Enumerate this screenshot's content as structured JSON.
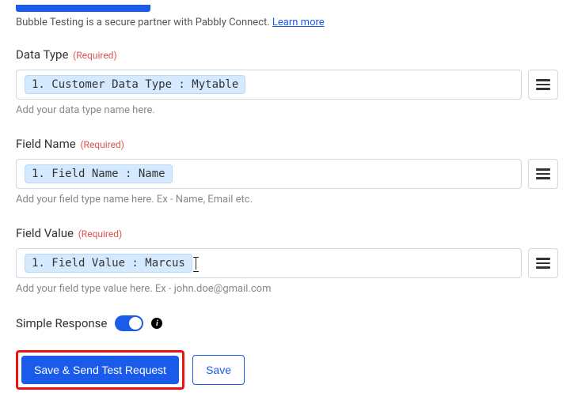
{
  "note": {
    "text_prefix": "Bubble Testing is a secure partner with Pabbly Connect. ",
    "link_text": "Learn more"
  },
  "fields": {
    "dataType": {
      "label": "Data Type",
      "required": "(Required)",
      "chip": "1. Customer Data Type : Mytable",
      "helper": "Add your data type name here."
    },
    "fieldName": {
      "label": "Field Name",
      "required": "(Required)",
      "chip": "1. Field Name : Name",
      "helper": "Add your field type name here. Ex - Name, Email etc."
    },
    "fieldValue": {
      "label": "Field Value",
      "required": "(Required)",
      "chip": "1. Field Value : Marcus",
      "helper": "Add your field type value here. Ex - john.doe@gmail.com"
    }
  },
  "simpleResponse": {
    "label": "Simple Response"
  },
  "buttons": {
    "saveSend": "Save & Send Test Request",
    "save": "Save"
  }
}
